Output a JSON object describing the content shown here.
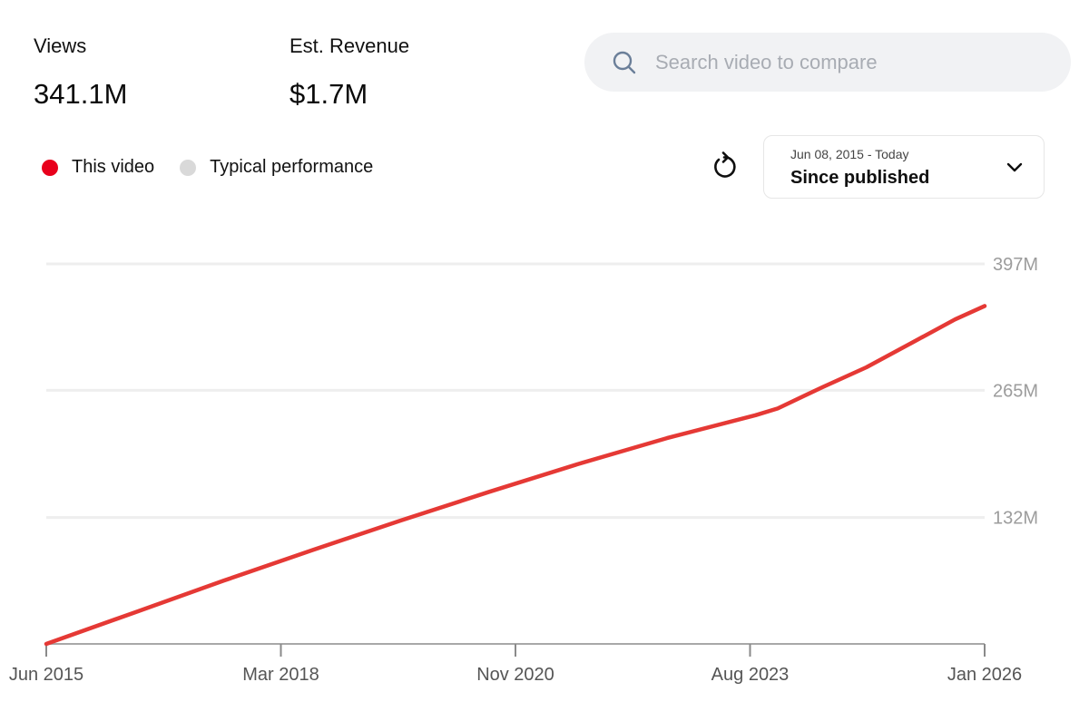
{
  "metrics": {
    "views": {
      "label": "Views",
      "value": "341.1M"
    },
    "revenue": {
      "label": "Est. Revenue",
      "value": "$1.7M"
    }
  },
  "search": {
    "placeholder": "Search video to compare",
    "icon": "search-icon"
  },
  "legend": [
    {
      "label": "This video",
      "color": "#e8001c"
    },
    {
      "label": "Typical performance",
      "color": "#d9d9d9"
    }
  ],
  "reload": {
    "icon": "reload-icon"
  },
  "date_range": {
    "range_text": "Jun 08, 2015 - Today",
    "selected": "Since published",
    "icon": "chevron-down-icon"
  },
  "chart_data": {
    "type": "line",
    "title": "",
    "xlabel": "",
    "ylabel": "",
    "x_ticks": [
      "Jun 2015",
      "Mar 2018",
      "Nov 2020",
      "Aug 2023",
      "Jan 2026"
    ],
    "y_ticks": [
      "397M",
      "265M",
      "132M"
    ],
    "ylim": [
      0,
      397
    ],
    "xlim": [
      "2015-06",
      "2026-01"
    ],
    "grid": true,
    "legend_position": "top-left",
    "series": [
      {
        "name": "This video",
        "color": "#e53935",
        "x": [
          "2015-06",
          "2016-06",
          "2017-06",
          "2018-06",
          "2019-06",
          "2020-06",
          "2021-06",
          "2022-06",
          "2023-06",
          "2023-09",
          "2024-03",
          "2024-09",
          "2025-03",
          "2025-09",
          "2026-01"
        ],
        "y": [
          0,
          33,
          66,
          98,
          129,
          159,
          188,
          215,
          239,
          246,
          268,
          289,
          314,
          339,
          353
        ]
      }
    ]
  }
}
